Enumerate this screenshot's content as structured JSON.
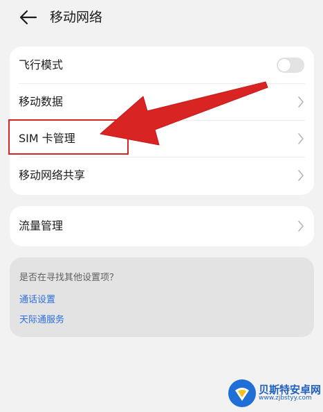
{
  "header": {
    "title": "移动网络",
    "back_icon": "arrow-left-icon"
  },
  "card1": {
    "items": [
      {
        "label": "飞行模式",
        "control": "toggle",
        "toggle_on": false
      },
      {
        "label": "移动数据",
        "control": "chevron"
      },
      {
        "label": "SIM 卡管理",
        "control": "chevron"
      },
      {
        "label": "移动网络共享",
        "control": "chevron"
      }
    ]
  },
  "card2": {
    "items": [
      {
        "label": "流量管理",
        "control": "chevron"
      }
    ]
  },
  "suggestions": {
    "title": "是否在寻找其他设置项？",
    "links": [
      "通话设置",
      "天际通服务"
    ]
  },
  "annotation": {
    "color": "#d92424"
  },
  "watermark": {
    "name": "贝斯特安卓网",
    "url": "www.zjbstyy.com"
  },
  "colors": {
    "background": "#f2f2f2",
    "card": "#ffffff",
    "link": "#2a6ee0",
    "toggle_off": "#e3e3e3"
  }
}
